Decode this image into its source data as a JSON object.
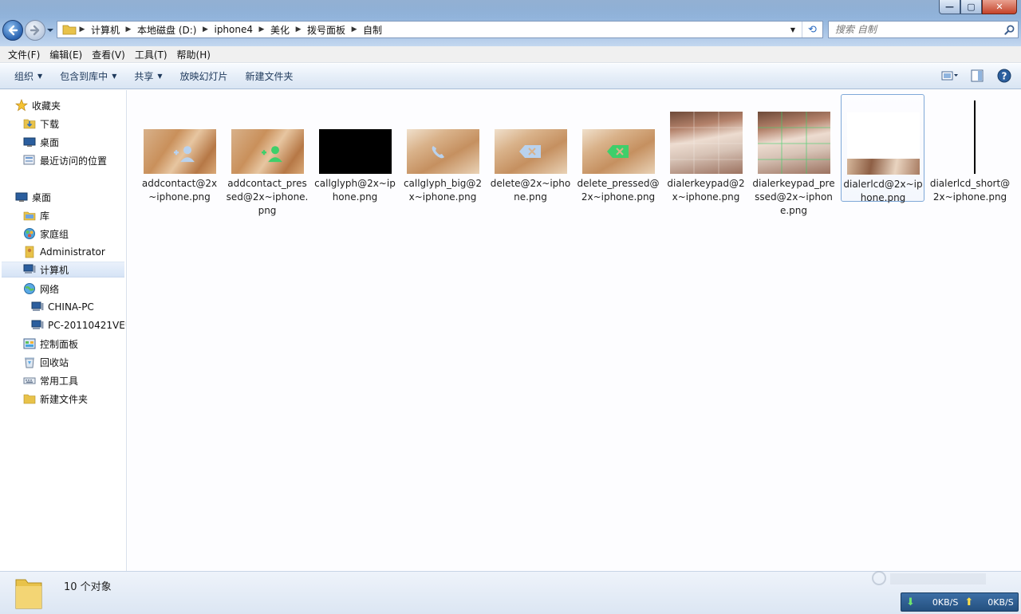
{
  "window": {
    "min_label": "—",
    "max_label": "▢",
    "close_label": "✕"
  },
  "address": {
    "breadcrumbs": [
      "计算机",
      "本地磁盘 (D:)",
      "iphone4",
      "美化",
      "拨号面板",
      "自制"
    ]
  },
  "search": {
    "placeholder": "搜索 自制"
  },
  "menu": [
    "文件(F)",
    "编辑(E)",
    "查看(V)",
    "工具(T)",
    "帮助(H)"
  ],
  "toolbar": {
    "organize": "组织",
    "include_library": "包含到库中",
    "share": "共享",
    "slideshow": "放映幻灯片",
    "new_folder": "新建文件夹"
  },
  "nav": {
    "favorites": "收藏夹",
    "downloads": "下载",
    "desktop_fav": "桌面",
    "recent": "最近访问的位置",
    "desktop": "桌面",
    "libraries": "库",
    "homegroup": "家庭组",
    "admin": "Administrator",
    "computer": "计算机",
    "network": "网络",
    "pc1": "CHINA-PC",
    "pc2": "PC-20110421VEU",
    "control_panel": "控制面板",
    "recycle_bin": "回收站",
    "tools": "常用工具",
    "new_folder": "新建文件夹"
  },
  "files": [
    {
      "name": "addcontact@2x~iphone.png",
      "thumb": "orange-person"
    },
    {
      "name": "addcontact_pressed@2x~iphone.png",
      "thumb": "orange-person-green"
    },
    {
      "name": "callglyph@2x~iphone.png",
      "thumb": "black"
    },
    {
      "name": "callglyph_big@2x~iphone.png",
      "thumb": "orange-phone"
    },
    {
      "name": "delete@2x~iphone.png",
      "thumb": "orange-delete"
    },
    {
      "name": "delete_pressed@2x~iphone.png",
      "thumb": "orange-delete-green"
    },
    {
      "name": "dialerkeypad@2x~iphone.png",
      "thumb": "photo"
    },
    {
      "name": "dialerkeypad_pressed@2x~iphone.png",
      "thumb": "photo-green"
    },
    {
      "name": "dialerlcd@2x~iphone.png",
      "thumb": "white-strip"
    },
    {
      "name": "dialerlcd_short@2x~iphone.png",
      "thumb": "black-line"
    }
  ],
  "status": {
    "count": "10 个对象",
    "download_speed": "0KB/S",
    "upload_speed": "0KB/S"
  },
  "colors": {
    "accent": "#2a63b0",
    "selection": "#d6e4f6",
    "green_glyph": "#3ecf6a"
  }
}
